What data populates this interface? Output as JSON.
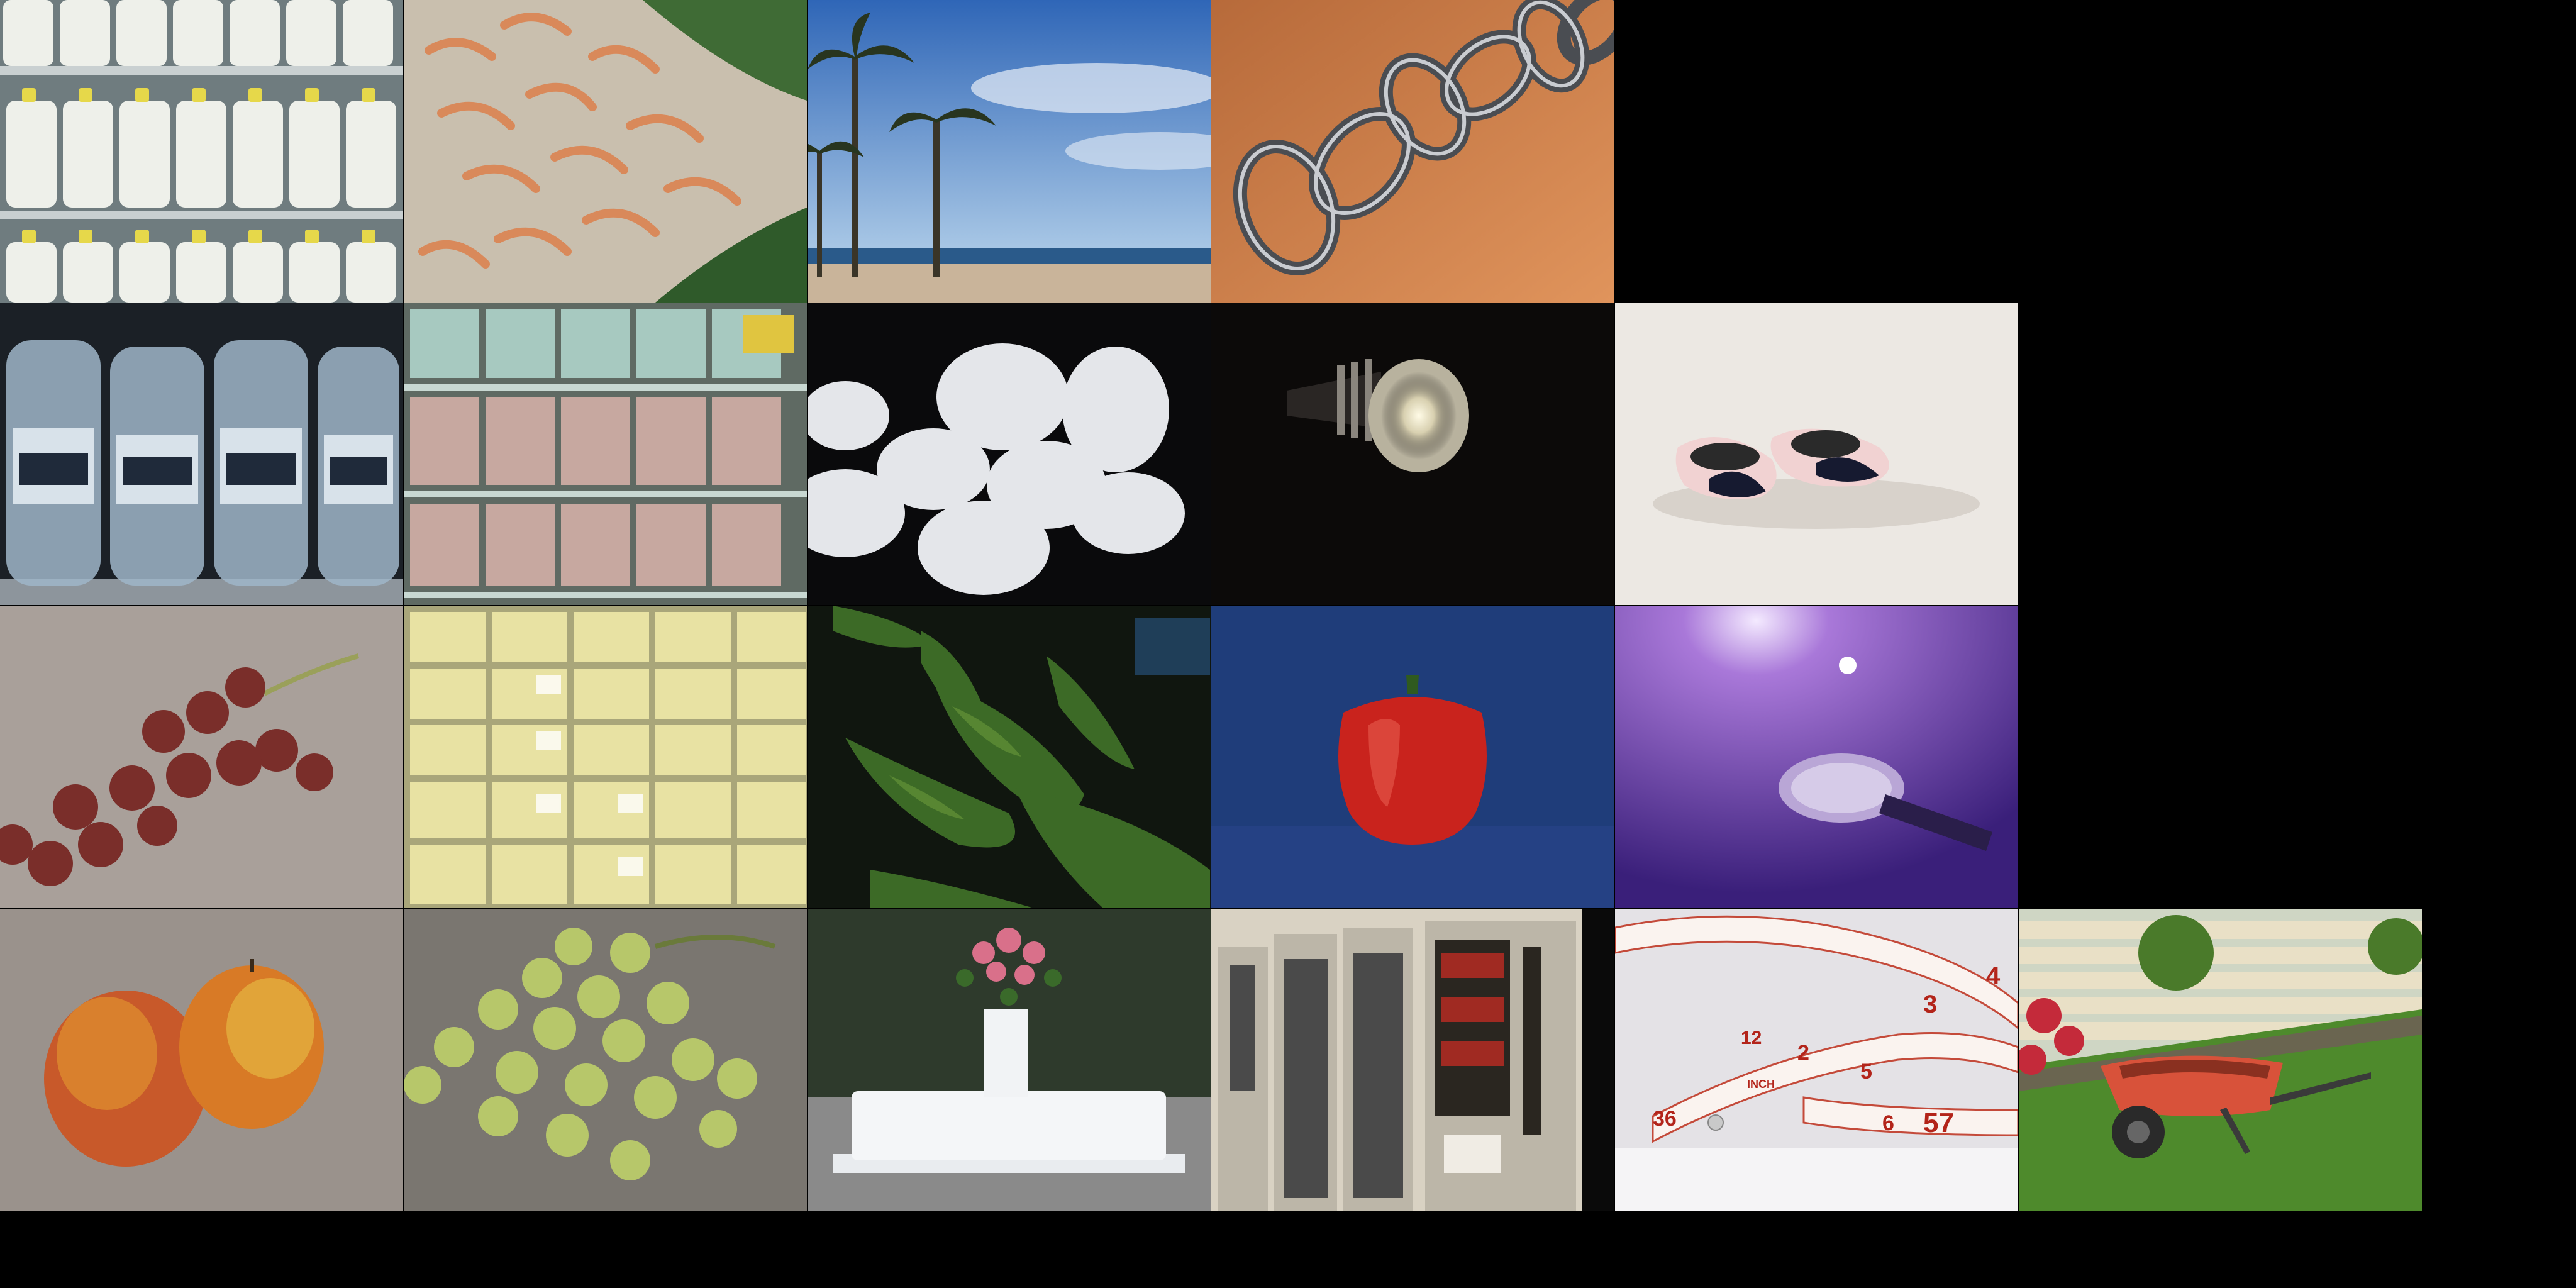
{
  "mosaic": {
    "background": "#000000",
    "rows": 4,
    "tiles": [
      {
        "id": "milk-jugs",
        "row": 0,
        "col": 0
      },
      {
        "id": "shrimp",
        "row": 0,
        "col": 1
      },
      {
        "id": "palm-beach",
        "row": 0,
        "col": 2
      },
      {
        "id": "chain",
        "row": 0,
        "col": 3
      },
      {
        "id": "water-bottles",
        "row": 1,
        "col": 0
      },
      {
        "id": "egg-cartons",
        "row": 1,
        "col": 1
      },
      {
        "id": "eggs",
        "row": 1,
        "col": 2
      },
      {
        "id": "spotlight",
        "row": 1,
        "col": 3
      },
      {
        "id": "slippers",
        "row": 1,
        "col": 4
      },
      {
        "id": "red-grapes",
        "row": 2,
        "col": 0
      },
      {
        "id": "cheese",
        "row": 2,
        "col": 1
      },
      {
        "id": "green-peppers",
        "row": 2,
        "col": 2
      },
      {
        "id": "red-pepper",
        "row": 2,
        "col": 3
      },
      {
        "id": "microphone",
        "row": 2,
        "col": 4
      },
      {
        "id": "peaches",
        "row": 3,
        "col": 0
      },
      {
        "id": "green-grapes",
        "row": 3,
        "col": 1
      },
      {
        "id": "wedding-cake",
        "row": 3,
        "col": 2
      },
      {
        "id": "vending-machines",
        "row": 3,
        "col": 3
      },
      {
        "id": "tape-measure",
        "row": 3,
        "col": 4
      },
      {
        "id": "wheelbarrow",
        "row": 3,
        "col": 5
      }
    ]
  },
  "tape_measure": {
    "marks": [
      "12",
      "2",
      "3",
      "4",
      "36",
      "INCH",
      "5",
      "6",
      "57"
    ]
  }
}
